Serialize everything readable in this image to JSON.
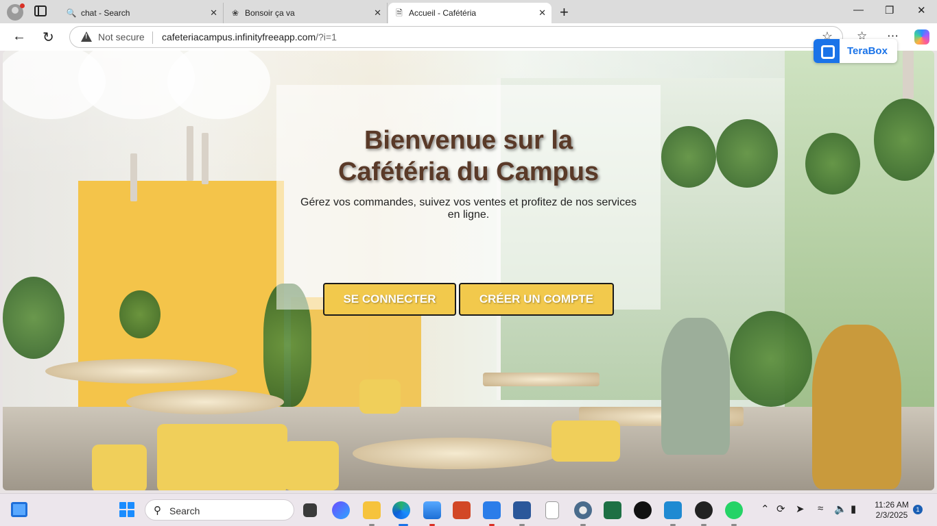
{
  "browser": {
    "tabs": [
      {
        "title": "chat - Search",
        "favicon": "search-icon",
        "active": false
      },
      {
        "title": "Bonsoir ça va",
        "favicon": "chatgpt-icon",
        "active": false
      },
      {
        "title": "Accueil - Cafétéria",
        "favicon": "page-icon",
        "active": true
      }
    ],
    "security_label": "Not secure",
    "url_host": "cafeteriacampus.infinityfreeapp.com",
    "url_path": "/?i=1"
  },
  "extension": {
    "label": "TeraBox",
    "color": "#1a73e8"
  },
  "hero": {
    "title_line1": "Bienvenue sur la",
    "title_line2": "Cafétéria du Campus",
    "subtitle": "Gérez vos commandes, suivez vos ventes et profitez de nos services en ligne.",
    "login_label": "SE CONNECTER",
    "signup_label": "CRÉER UN COMPTE",
    "title_color": "#5a3a28",
    "button_color": "#f2c94c"
  },
  "taskbar": {
    "search_placeholder": "Search",
    "apps": [
      "file-explorer",
      "copilot",
      "files",
      "edge",
      "photos",
      "powerpoint",
      "store",
      "word",
      "notepad",
      "settings",
      "excel",
      "tiktok",
      "vscode",
      "media-player",
      "whatsapp"
    ],
    "time": "11:26 AM",
    "date": "2/3/2025",
    "notification_count": "1"
  }
}
